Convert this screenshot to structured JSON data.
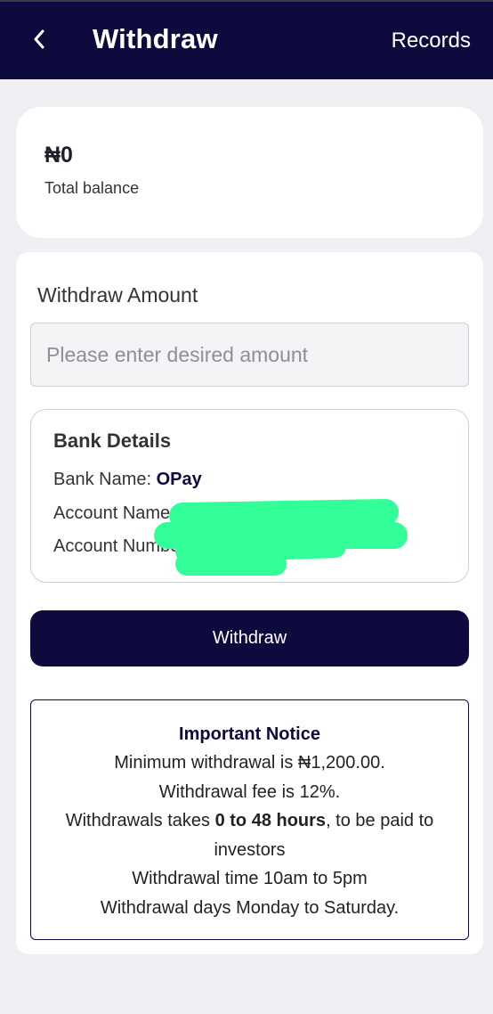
{
  "header": {
    "title": "Withdraw",
    "records_label": "Records",
    "back_icon": "chevron-left-icon",
    "background": "#0d0a3d"
  },
  "balance": {
    "amount": "₦0",
    "label": "Total balance"
  },
  "withdraw_form": {
    "amount_label": "Withdraw Amount",
    "amount_placeholder": "Please enter desired amount",
    "amount_value": ""
  },
  "bank_details": {
    "title": "Bank Details",
    "bank_name_label": "Bank Name:",
    "bank_name_value": "OPay",
    "account_name_label": "Account Name",
    "account_number_label": "Account Number",
    "redaction_color": "#33ff99"
  },
  "withdraw_button": {
    "label": "Withdraw"
  },
  "notice": {
    "title": "Important Notice",
    "min_withdrawal": "Minimum withdrawal is ₦1,200.00.",
    "fee": "Withdrawal fee is 12%.",
    "duration_prefix": "Withdrawals takes ",
    "duration_bold": "0 to 48 hours",
    "duration_suffix": ", to be paid to investors",
    "time": "Withdrawal time 10am to 5pm",
    "days": "Withdrawal days Monday to Saturday."
  }
}
